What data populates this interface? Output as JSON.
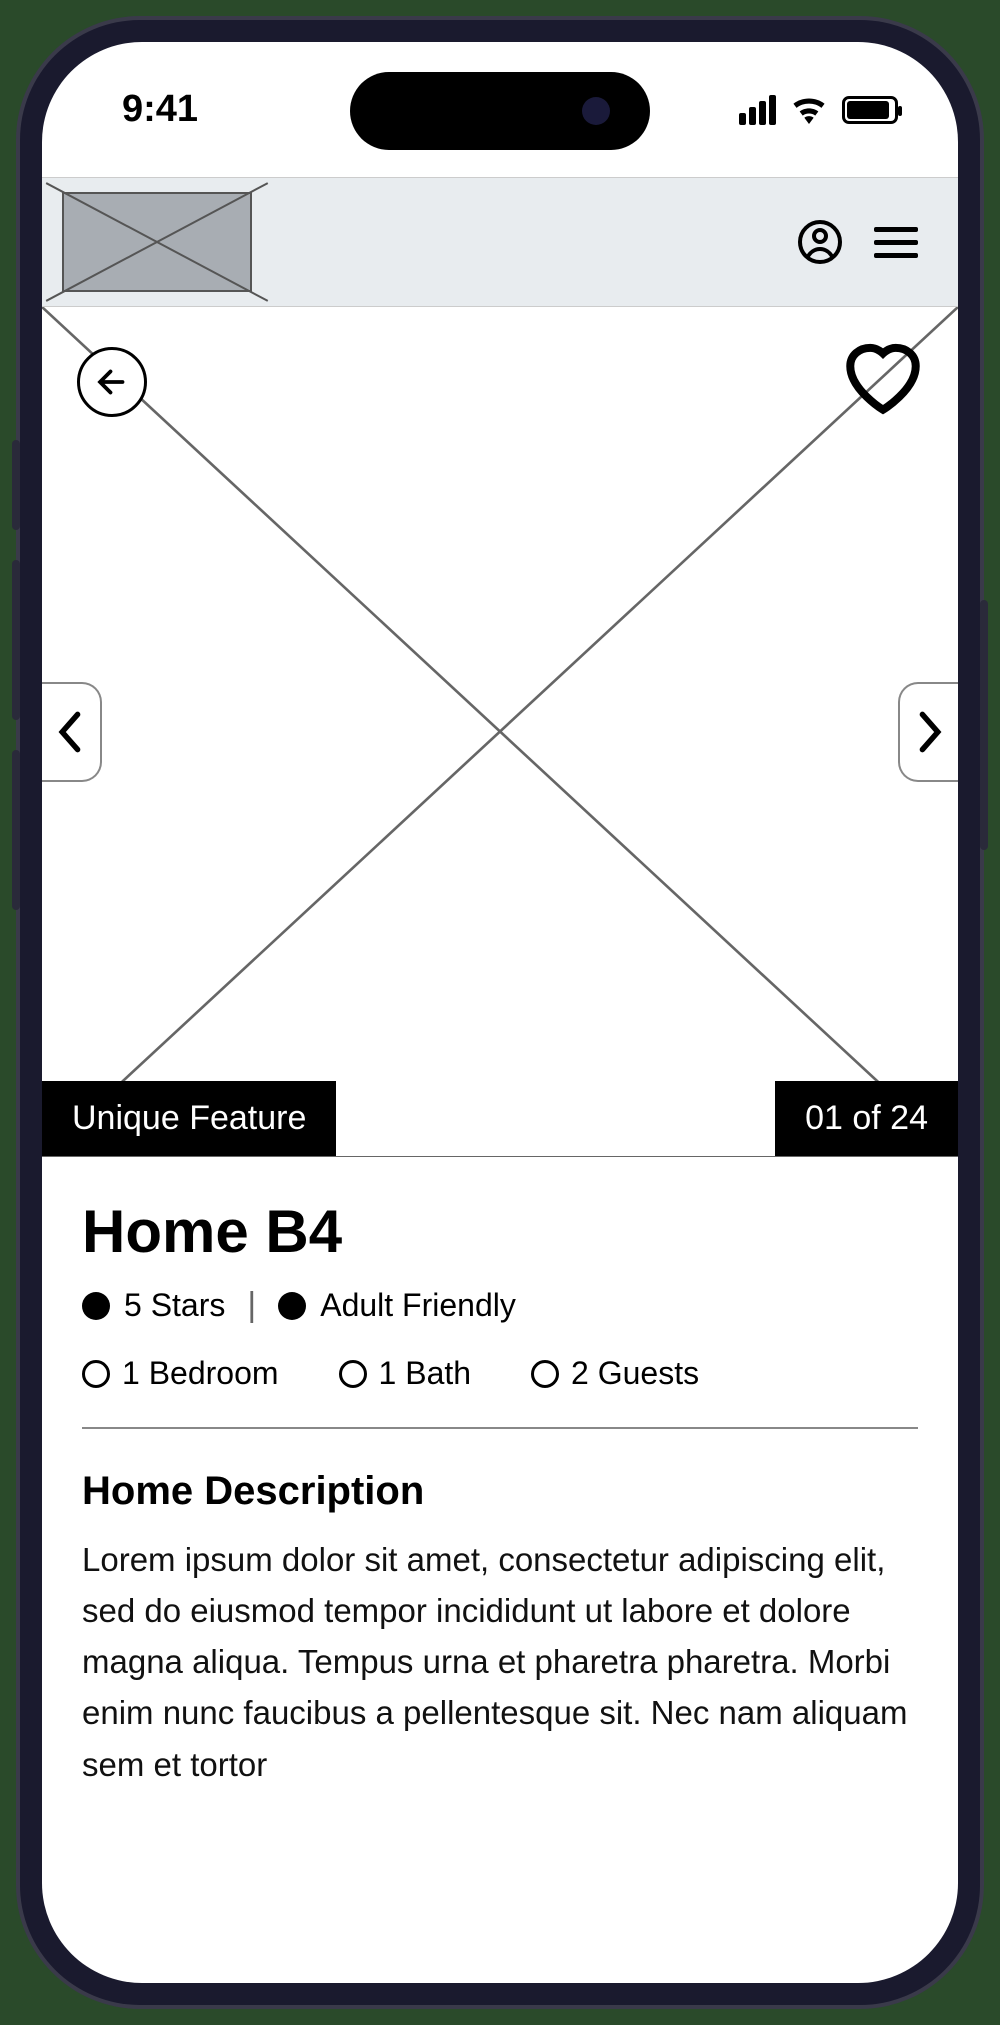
{
  "statusbar": {
    "time": "9:41"
  },
  "hero": {
    "feature_badge": "Unique Feature",
    "counter": "01 of 24"
  },
  "listing": {
    "title": "Home B4",
    "tags": {
      "rating": "5 Stars",
      "audience": "Adult Friendly"
    },
    "specs": {
      "bedrooms": "1 Bedroom",
      "baths": "1 Bath",
      "guests": "2 Guests"
    }
  },
  "description": {
    "heading": "Home Description",
    "body": "Lorem ipsum dolor sit amet, consectetur adipiscing elit, sed do eiusmod tempor incididunt ut labore et dolore magna aliqua. Tempus urna et pharetra pharetra. Morbi enim nunc faucibus a pellentesque sit. Nec nam aliquam sem et tortor"
  }
}
